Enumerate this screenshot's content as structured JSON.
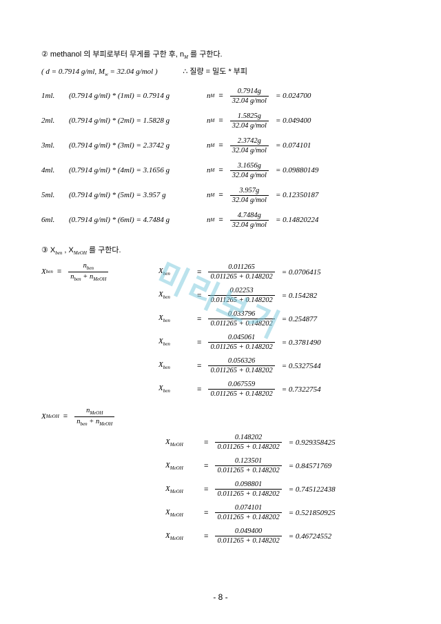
{
  "section2": {
    "title": "② methanol 의 부피로부터 무게를 구한 후, n",
    "title_sub": "M",
    "title_tail": " 를 구한다.",
    "params_left": "( d = 0.7914 g/ml,   M",
    "params_sub": "w",
    "params_mid": " = 32.04 g/mol )",
    "params_right": "∴ 질량  =  밀도  *  부피",
    "frac_den": "32.04 g/mol",
    "rows": [
      {
        "vol": "1ml.",
        "mass": "(0.7914 g/ml) * (1ml)  = 0.7914 g",
        "n": "n",
        "sub": "M",
        "num": "0.7914g",
        "res": " = 0.024700"
      },
      {
        "vol": "2ml.",
        "mass": "(0.7914 g/ml) * (2ml)  = 1.5828 g",
        "n": "n",
        "sub": "M",
        "num": "1.5825g",
        "res": " = 0.049400"
      },
      {
        "vol": "3ml.",
        "mass": "(0.7914 g/ml) * (3ml)  = 2.3742 g",
        "n": "n",
        "sub": "M",
        "num": "2.3742g",
        "res": " = 0.074101"
      },
      {
        "vol": "4ml.",
        "mass": "(0.7914 g/ml) * (4ml)  = 3.1656 g",
        "n": "n",
        "sub": "M",
        "num": "3.1656g",
        "res": " = 0.09880149"
      },
      {
        "vol": "5ml.",
        "mass": "(0.7914 g/ml) * (5ml)  = 3.957 g",
        "n": "n",
        "sub": "M",
        "num": "3.957g",
        "res": " = 0.12350187"
      },
      {
        "vol": "6ml.",
        "mass": "(0.7914 g/ml) * (6ml)  = 4.7484 g",
        "n": "n",
        "sub": "M",
        "num": "4.7484g",
        "res": " = 0.14820224"
      }
    ]
  },
  "section3": {
    "title": "③ X",
    "s1": "ben",
    "mid": " ,  X",
    "s2": "MeOH",
    "tail": " 를 구한다.",
    "def1": {
      "label": "X",
      "sub": "ben",
      "num": "n",
      "numsub": "ben",
      "den1": "n",
      "den1sub": "ben",
      "plus": " + ",
      "den2": "n",
      "den2sub": "MeOH"
    },
    "def2": {
      "label": "X",
      "sub": "MeOH",
      "num": "n",
      "numsub": "MeOH",
      "den1": "n",
      "den1sub": "ben",
      "plus": " + ",
      "den2": "n",
      "den2sub": "MeOH"
    },
    "den_common": "0.011265 + 0.148202",
    "xben": [
      {
        "num": "0.011265",
        "res": " = 0.0706415"
      },
      {
        "num": "0.02253",
        "res": " = 0.154282"
      },
      {
        "num": "0.033796",
        "res": " = 0.254877"
      },
      {
        "num": "0.045061",
        "res": " = 0.3781490"
      },
      {
        "num": "0.056326",
        "res": " = 0.5327544"
      },
      {
        "num": "0.067559",
        "res": " = 0.7322754"
      }
    ],
    "xmeoh": [
      {
        "num": "0.148202",
        "res": " = 0.929358425"
      },
      {
        "num": "0.123501",
        "res": " = 0.84571769"
      },
      {
        "num": "0.098801",
        "res": " = 0.745122438"
      },
      {
        "num": "0.074101",
        "res": " = 0.521850925"
      },
      {
        "num": "0.049400",
        "res": " = 0.46724552"
      }
    ],
    "xben_label": "X",
    "xben_sub": "ben",
    "xmeoh_label": "X",
    "xmeoh_sub": "MeOH"
  },
  "watermark": "미리보기",
  "pagenum": "- 8 -"
}
